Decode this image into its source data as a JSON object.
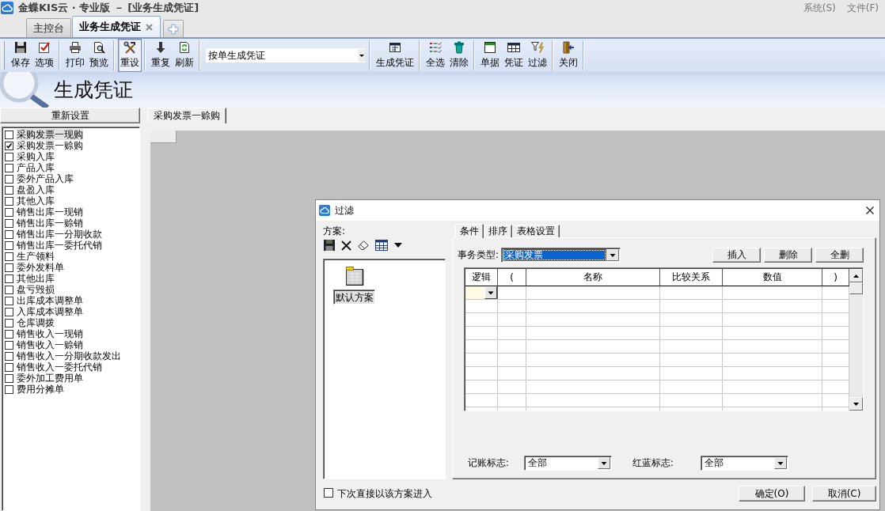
{
  "window": {
    "title": "金蝶KIS云 · 专业版 － [业务生成凭证]",
    "menu": [
      "系统(S)",
      "文件(F)"
    ]
  },
  "tabs": [
    {
      "label": "主控台",
      "selected": false
    },
    {
      "label": "业务生成凭证",
      "selected": true
    }
  ],
  "toolbar": [
    {
      "kind": "buttons",
      "buttons": [
        {
          "kind": "save",
          "label": "保存",
          "pressed": false
        },
        {
          "kind": "options",
          "label": "选项",
          "pressed": false
        }
      ]
    },
    {
      "kind": "buttons",
      "buttons": [
        {
          "kind": "print",
          "label": "打印",
          "pressed": false
        },
        {
          "kind": "preview",
          "label": "预览",
          "pressed": false
        }
      ]
    },
    {
      "kind": "buttons",
      "buttons": [
        {
          "kind": "reset",
          "label": "重设",
          "pressed": true
        }
      ]
    },
    {
      "kind": "buttons",
      "buttons": [
        {
          "kind": "repeat",
          "label": "重复",
          "pressed": false
        },
        {
          "kind": "refresh",
          "label": "刷新",
          "pressed": false
        }
      ]
    },
    {
      "kind": "dropdown",
      "value": "按单生成凭证"
    },
    {
      "kind": "buttons",
      "buttons": [
        {
          "kind": "generate",
          "label": "生成凭证",
          "pressed": false
        }
      ]
    },
    {
      "kind": "buttons",
      "buttons": [
        {
          "kind": "selectall",
          "label": "全选",
          "pressed": false
        },
        {
          "kind": "clear",
          "label": "清除",
          "pressed": false
        }
      ]
    },
    {
      "kind": "buttons",
      "buttons": [
        {
          "kind": "bill",
          "label": "单据",
          "pressed": false
        },
        {
          "kind": "voucher",
          "label": "凭证",
          "pressed": false
        },
        {
          "kind": "filter",
          "label": "过滤",
          "pressed": false
        }
      ]
    },
    {
      "kind": "buttons",
      "buttons": [
        {
          "kind": "close",
          "label": "关闭",
          "pressed": false
        }
      ]
    }
  ],
  "banner": {
    "title": "生成凭证"
  },
  "sidebar": {
    "reset_button": "重新设置",
    "items": [
      {
        "label": "采购发票一现购",
        "checked": false,
        "selected": true
      },
      {
        "label": "采购发票一赊购",
        "checked": true,
        "selected": false
      },
      {
        "label": "采购入库",
        "checked": false,
        "selected": false
      },
      {
        "label": "产品入库",
        "checked": false,
        "selected": false
      },
      {
        "label": "委外产品入库",
        "checked": false,
        "selected": false
      },
      {
        "label": "盘盈入库",
        "checked": false,
        "selected": false
      },
      {
        "label": "其他入库",
        "checked": false,
        "selected": false
      },
      {
        "label": "销售出库一现销",
        "checked": false,
        "selected": false
      },
      {
        "label": "销售出库一赊销",
        "checked": false,
        "selected": false
      },
      {
        "label": "销售出库一分期收款",
        "checked": false,
        "selected": false
      },
      {
        "label": "销售出库一委托代销",
        "checked": false,
        "selected": false
      },
      {
        "label": "生产领料",
        "checked": false,
        "selected": false
      },
      {
        "label": "委外发料单",
        "checked": false,
        "selected": false
      },
      {
        "label": "其他出库",
        "checked": false,
        "selected": false
      },
      {
        "label": "盘亏毁损",
        "checked": false,
        "selected": false
      },
      {
        "label": "出库成本调整单",
        "checked": false,
        "selected": false
      },
      {
        "label": "入库成本调整单",
        "checked": false,
        "selected": false
      },
      {
        "label": "仓库调拨",
        "checked": false,
        "selected": false
      },
      {
        "label": "销售收入一现销",
        "checked": false,
        "selected": false
      },
      {
        "label": "销售收入一赊销",
        "checked": false,
        "selected": false
      },
      {
        "label": "销售收入一分期收款发出",
        "checked": false,
        "selected": false
      },
      {
        "label": "销售收入一委托代销",
        "checked": false,
        "selected": false
      },
      {
        "label": "委外加工费用单",
        "checked": false,
        "selected": false
      },
      {
        "label": "费用分摊单",
        "checked": false,
        "selected": false
      }
    ]
  },
  "content": {
    "tabs": [
      {
        "label": "采购发票一赊购",
        "selected": true
      }
    ]
  },
  "dialog": {
    "title": "过滤",
    "scheme_label": "方案:",
    "schemes": [
      {
        "label": "默认方案",
        "selected": true
      }
    ],
    "tabs": [
      {
        "label": "条件",
        "selected": true
      },
      {
        "label": "排序",
        "selected": false
      },
      {
        "label": "表格设置",
        "selected": false
      }
    ],
    "business_type": {
      "label": "事务类型:",
      "value": "采购发票",
      "highlighted": true
    },
    "grid_buttons": [
      "插入",
      "删除",
      "全删"
    ],
    "grid": {
      "columns": [
        "逻辑",
        "(",
        "名称",
        "比较关系",
        "数值",
        ")"
      ]
    },
    "filters": [
      {
        "label": "记账标志:",
        "value": "全部",
        "highlighted": false
      },
      {
        "label": "红蓝标志:",
        "value": "全部",
        "highlighted": false
      }
    ],
    "remember": {
      "label": "下次直接以该方案进入",
      "checked": false
    },
    "buttons": [
      "确定(O)",
      "取消(C)"
    ]
  }
}
